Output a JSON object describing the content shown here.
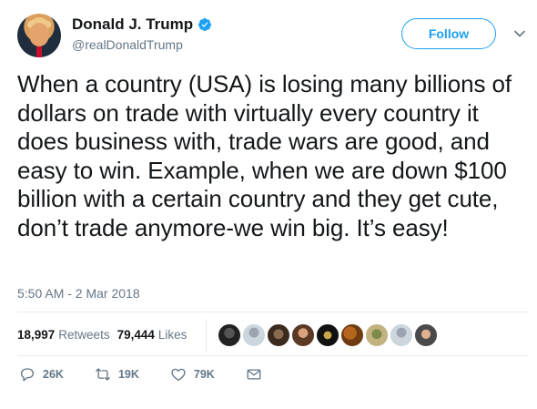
{
  "author": {
    "name": "Donald J. Trump",
    "handle": "@realDonaldTrump",
    "verified_icon": "verified-badge-icon",
    "avatar_icon": "profile-avatar"
  },
  "follow": {
    "label": "Follow"
  },
  "menu": {
    "icon": "chevron-down-icon"
  },
  "tweet": {
    "text": "When a country (USA) is losing many billions of dollars on trade with virtually every country it does business with, trade wars are good, and easy to win. Example, when we are down $100 billion with a certain country and they get cute, don’t trade anymore-we win big. It’s easy!",
    "timestamp": "5:50 AM - 2 Mar 2018"
  },
  "stats": {
    "retweets_count": "18,997",
    "retweets_label": "Retweets",
    "likes_count": "79,444",
    "likes_label": "Likes",
    "liker_count": 9
  },
  "actions": {
    "reply_count": "26K",
    "retweet_count": "19K",
    "like_count": "79K"
  },
  "colors": {
    "accent": "#1da1f2",
    "text": "#14171a",
    "muted": "#657786",
    "divider": "#e6ecf0"
  }
}
